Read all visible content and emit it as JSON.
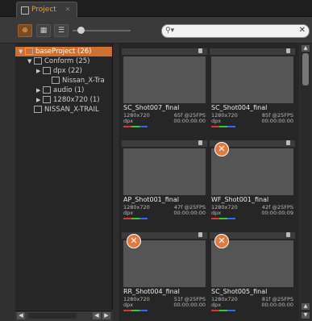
{
  "window": {
    "tab_title": "Project"
  },
  "toolbar": {
    "search_placeholder": ""
  },
  "tree": {
    "items": [
      {
        "label": "baseProject (26)",
        "indent": 0,
        "expanded": true,
        "selected": true
      },
      {
        "label": "Conform (25)",
        "indent": 1,
        "expanded": true
      },
      {
        "label": "dpx (22)",
        "indent": 2,
        "expanded": false
      },
      {
        "label": "Nissan_X-Tra",
        "indent": 3
      },
      {
        "label": "audio (1)",
        "indent": 2,
        "expanded": false
      },
      {
        "label": "1280x720 (1)",
        "indent": 2,
        "expanded": false
      },
      {
        "label": "NISSAN_X-TRAIL",
        "indent": 1
      }
    ]
  },
  "clips": [
    {
      "name": "SC_Shot007_final",
      "res": "1280x720",
      "frames": "65f @25FPS",
      "fmt": "dpx",
      "tc": "00:00:00:00",
      "badge": false
    },
    {
      "name": "SC_Shot004_final",
      "res": "1280x720",
      "frames": "85f @25FPS",
      "fmt": "dpx",
      "tc": "00:00:00:00",
      "badge": false
    },
    {
      "name": "AP_Shot001_final",
      "res": "1280x720",
      "frames": "47f @25FPS",
      "fmt": "dpx",
      "tc": "00:00:00:00",
      "badge": false
    },
    {
      "name": "WF_Shot001_final",
      "res": "1280x720",
      "frames": "42f @25FPS",
      "fmt": "dpx",
      "tc": "00:00:00:09",
      "badge": true
    },
    {
      "name": "RR_Shot004_final",
      "res": "1280x720",
      "frames": "51f @25FPS",
      "fmt": "dpx",
      "tc": "00:00:00:00",
      "badge": true
    },
    {
      "name": "SC_Shot005_final",
      "res": "1280x720",
      "frames": "81f @25FPS",
      "fmt": "dpx",
      "tc": "00:00:00:00",
      "badge": true
    }
  ],
  "colors": {
    "accent": "#d07030",
    "badge": "#e07a40"
  }
}
